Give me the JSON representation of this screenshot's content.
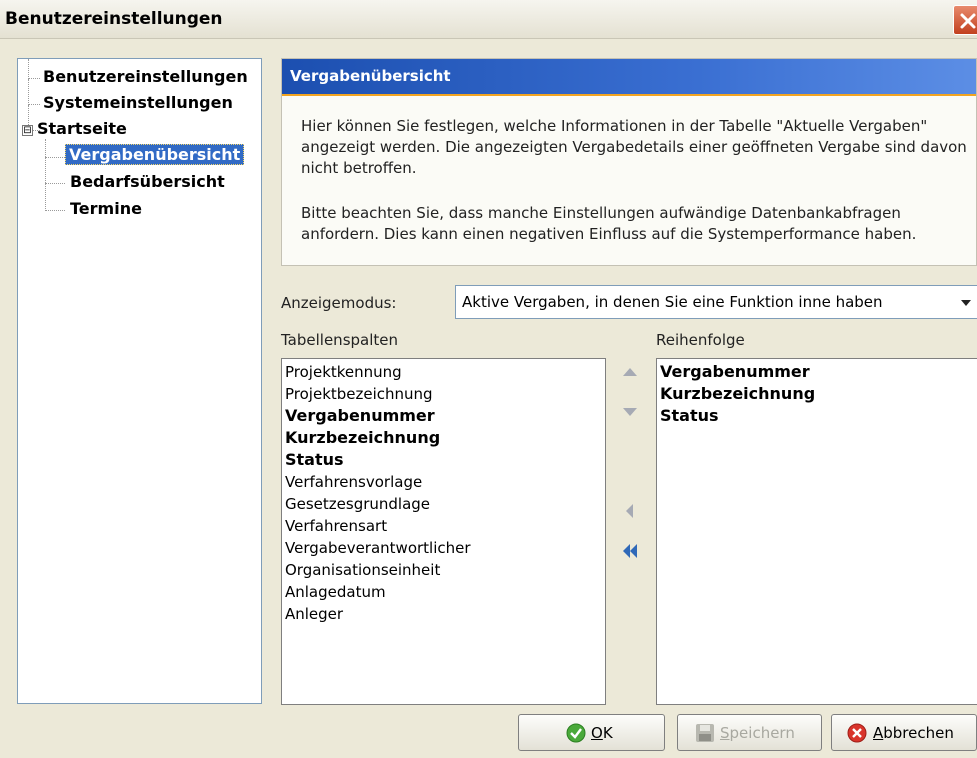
{
  "window": {
    "title": "Benutzereinstellungen"
  },
  "tree": {
    "items": [
      {
        "label": "Benutzereinstellungen"
      },
      {
        "label": "Systemeinstellungen"
      },
      {
        "label": "Startseite"
      },
      {
        "label": "Vergabenübersicht"
      },
      {
        "label": "Bedarfsübersicht"
      },
      {
        "label": "Termine"
      }
    ],
    "expander": "⊟",
    "selected": "Vergabenübersicht"
  },
  "panel": {
    "title": "Vergabenübersicht",
    "description_1": "Hier können Sie festlegen, welche Informationen in der Tabelle \"Aktuelle Vergaben\" angezeigt werden. Die angezeigten Vergabedetails einer geöffneten Vergabe sind davon nicht betroffen.",
    "description_2": "Bitte beachten Sie, dass manche Einstellungen aufwändige Datenbankabfragen anfordern. Dies kann einen negativen Einfluss auf die Systemperformance haben."
  },
  "display_mode": {
    "label": "Anzeigemodus:",
    "value": "Aktive Vergaben, in denen Sie eine Funktion inne haben"
  },
  "columns": {
    "label": "Tabellenspalten",
    "items": [
      {
        "label": "Projektkennung",
        "bold": false
      },
      {
        "label": "Projektbezeichnung",
        "bold": false
      },
      {
        "label": "Vergabenummer",
        "bold": true
      },
      {
        "label": "Kurzbezeichnung",
        "bold": true
      },
      {
        "label": "Status",
        "bold": true
      },
      {
        "label": "Verfahrensvorlage",
        "bold": false
      },
      {
        "label": "Gesetzesgrundlage",
        "bold": false
      },
      {
        "label": "Verfahrensart",
        "bold": false
      },
      {
        "label": "Vergabeverantwortlicher",
        "bold": false
      },
      {
        "label": "Organisationseinheit",
        "bold": false
      },
      {
        "label": "Anlagedatum",
        "bold": false
      },
      {
        "label": "Anleger",
        "bold": false
      }
    ]
  },
  "order": {
    "label": "Reihenfolge",
    "items": [
      {
        "label": "Vergabenummer"
      },
      {
        "label": "Kurzbezeichnung"
      },
      {
        "label": "Status"
      }
    ]
  },
  "icons": {
    "move_up": "triangle-up-icon",
    "move_down": "triangle-down-icon",
    "remove": "triangle-left-icon",
    "remove_all": "double-left-icon"
  },
  "buttons": {
    "ok_mnemonic": "O",
    "ok_rest": "K",
    "save_mnemonic": "S",
    "save_rest": "peichern",
    "cancel_mnemonic": "A",
    "cancel_rest": "bbrechen"
  },
  "colors": {
    "header": "#1c4fb0",
    "header_accent": "#f2a421",
    "selection": "#316ac5",
    "ok_icon": "#4aa93a",
    "cancel_icon": "#d9342b"
  }
}
